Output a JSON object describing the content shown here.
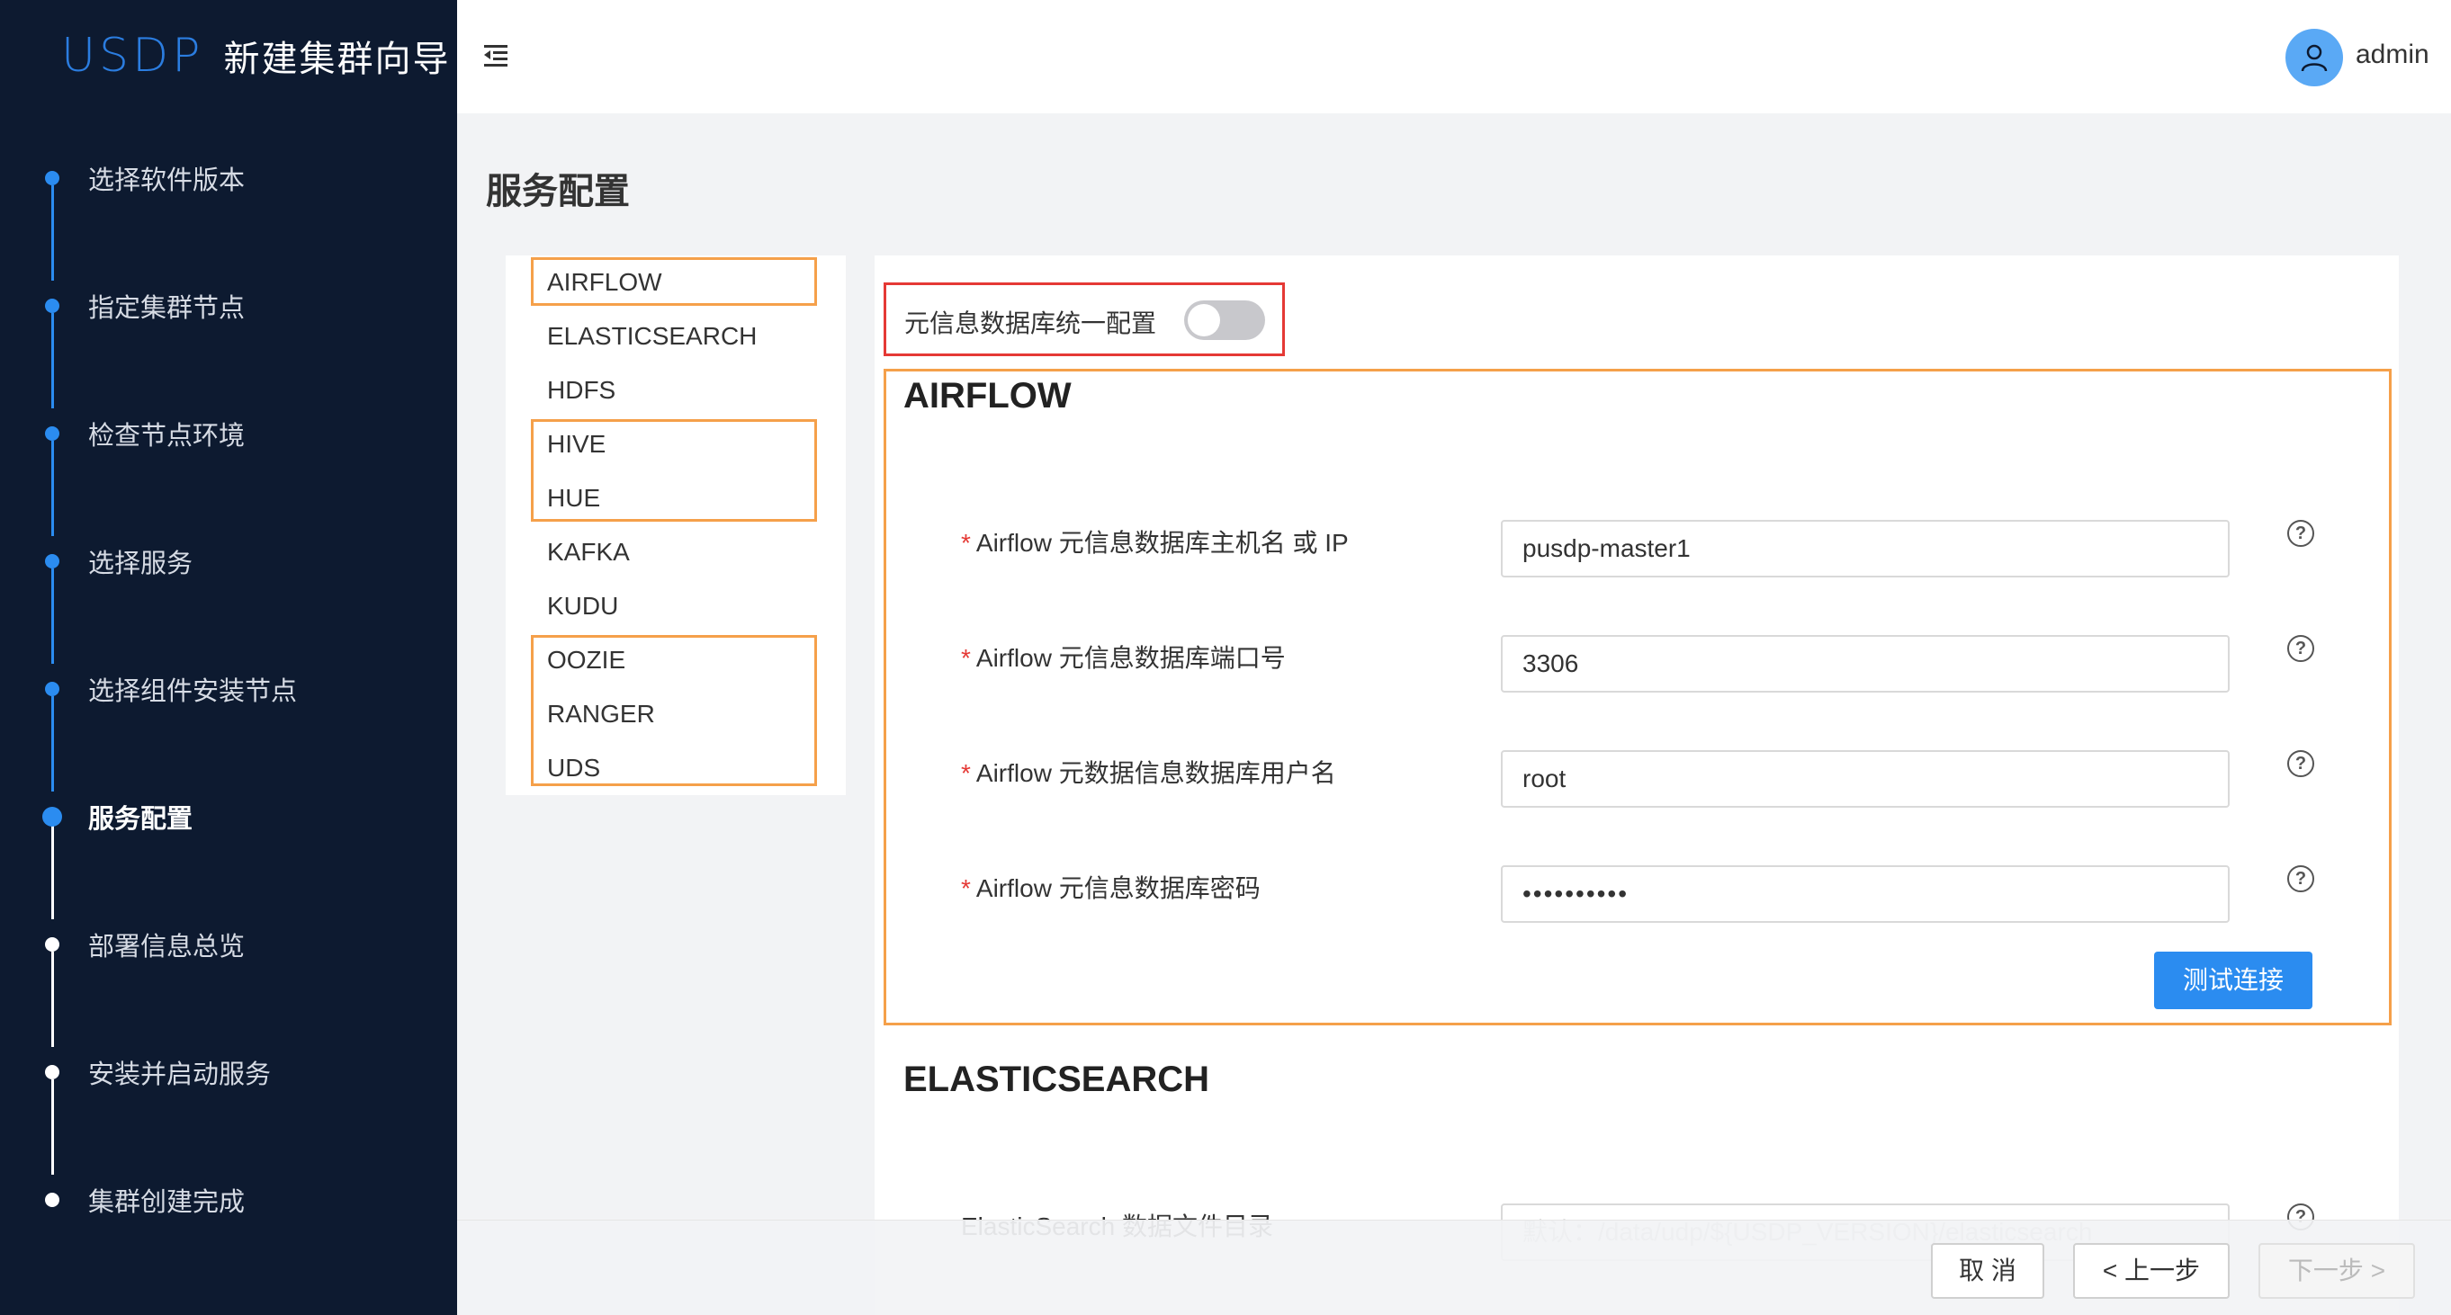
{
  "sidebar": {
    "logo_mark": "USDP",
    "title": "新建集群向导",
    "steps": [
      {
        "label": "选择软件版本"
      },
      {
        "label": "指定集群节点"
      },
      {
        "label": "检查节点环境"
      },
      {
        "label": "选择服务"
      },
      {
        "label": "选择组件安装节点"
      },
      {
        "label": "服务配置"
      },
      {
        "label": "部署信息总览"
      },
      {
        "label": "安装并启动服务"
      },
      {
        "label": "集群创建完成"
      }
    ]
  },
  "header": {
    "username": "admin"
  },
  "page": {
    "title": "服务配置"
  },
  "services": [
    "AIRFLOW",
    "ELASTICSEARCH",
    "HDFS",
    "HIVE",
    "HUE",
    "KAFKA",
    "KUDU",
    "OOZIE",
    "RANGER",
    "UDS"
  ],
  "toggle": {
    "label": "元信息数据库统一配置",
    "on": false
  },
  "airflow": {
    "title": "AIRFLOW",
    "fields": [
      {
        "label": "Airflow 元信息数据库主机名 或 IP",
        "value": "pusdp-master1"
      },
      {
        "label": "Airflow 元信息数据库端口号",
        "value": "3306"
      },
      {
        "label": "Airflow 元数据信息数据库用户名",
        "value": "root"
      },
      {
        "label": "Airflow 元信息数据库密码",
        "value": "••••••••••"
      }
    ],
    "test_button": "测试连接"
  },
  "elasticsearch": {
    "title": "ELASTICSEARCH",
    "field_label": "ElasticSearch 数据文件目录",
    "field_placeholder": "默认：/data/udp/${USDP_VERSION}/elasticsearch"
  },
  "footer": {
    "cancel": "取 消",
    "prev": "< 上一步",
    "next": "下一步 >"
  },
  "colors": {
    "sidebar_bg": "#0d1a30",
    "accent": "#2b8cf0",
    "highlight_orange": "#f5a04a",
    "highlight_red": "#e53935"
  }
}
